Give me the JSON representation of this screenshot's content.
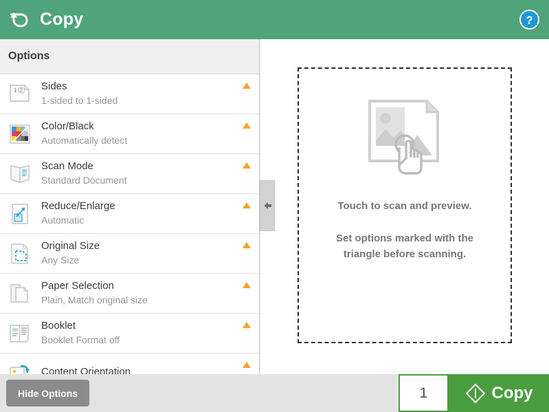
{
  "header": {
    "title": "Copy",
    "back_icon": "back-arrow-icon",
    "help_icon": "help-question-icon"
  },
  "sidebar": {
    "section_label": "Options",
    "collapse_icon": "arrow-left-icon",
    "items": [
      {
        "label": "Sides",
        "value": "1-sided to 1-sided",
        "icon": "sides-document-icon",
        "warning": true
      },
      {
        "label": "Color/Black",
        "value": "Automatically detect",
        "icon": "color-black-grid-icon",
        "warning": true
      },
      {
        "label": "Scan Mode",
        "value": "Standard Document",
        "icon": "open-book-icon",
        "warning": true
      },
      {
        "label": "Reduce/Enlarge",
        "value": "Automatic",
        "icon": "resize-arrows-icon",
        "warning": true
      },
      {
        "label": "Original Size",
        "value": "Any Size",
        "icon": "original-size-page-icon",
        "warning": true
      },
      {
        "label": "Paper Selection",
        "value": "Plain, Match original size",
        "icon": "paper-stack-icon",
        "warning": true
      },
      {
        "label": "Booklet",
        "value": "Booklet Format off",
        "icon": "booklet-icon",
        "warning": true
      },
      {
        "label": "Content Orientation",
        "value": "",
        "icon": "content-orientation-icon",
        "warning": true
      }
    ]
  },
  "preview": {
    "placeholder_icon": "image-touch-placeholder-icon",
    "line1": "Touch to scan and preview.",
    "line2": "Set options marked with the triangle before scanning."
  },
  "bottom": {
    "hide_options_label": "Hide Options",
    "copy_count": "1",
    "copy_label": "Copy",
    "copy_icon": "start-diamond-icon"
  },
  "colors": {
    "header_green": "#4fa47c",
    "action_green": "#4a9e3f",
    "warning_orange": "#f0a530",
    "help_blue": "#1b9ad6",
    "accent_blue": "#2e9bd6"
  }
}
